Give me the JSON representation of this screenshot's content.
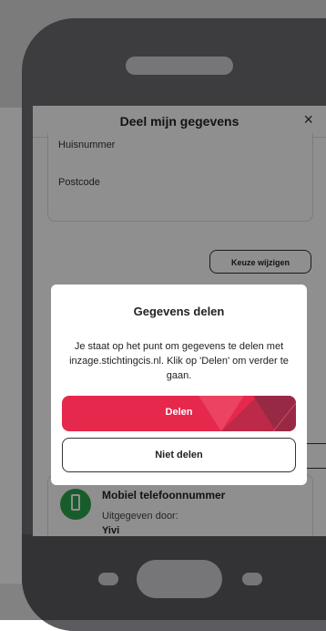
{
  "modal": {
    "title": "Deel mijn gegevens",
    "close_label": "×"
  },
  "form": {
    "huisnummer_label": "Huisnummer",
    "postcode_label": "Postcode"
  },
  "change_button": "Keuze wijzigen",
  "item": {
    "title": "Mobiel telefoonnummer",
    "issued_label": "Uitgegeven door:",
    "issuer": "Yivi",
    "icon": "phone-icon",
    "icon_color": "#2ea44f"
  },
  "dialog": {
    "title": "Gegevens delen",
    "message": "Je staat op het punt om gegevens te delen met inzage.stichtingcis.nl. Klik op 'Delen' om verder te gaan.",
    "primary_button": "Delen",
    "secondary_button": "Niet delen",
    "accent_color": "#e5284c"
  }
}
